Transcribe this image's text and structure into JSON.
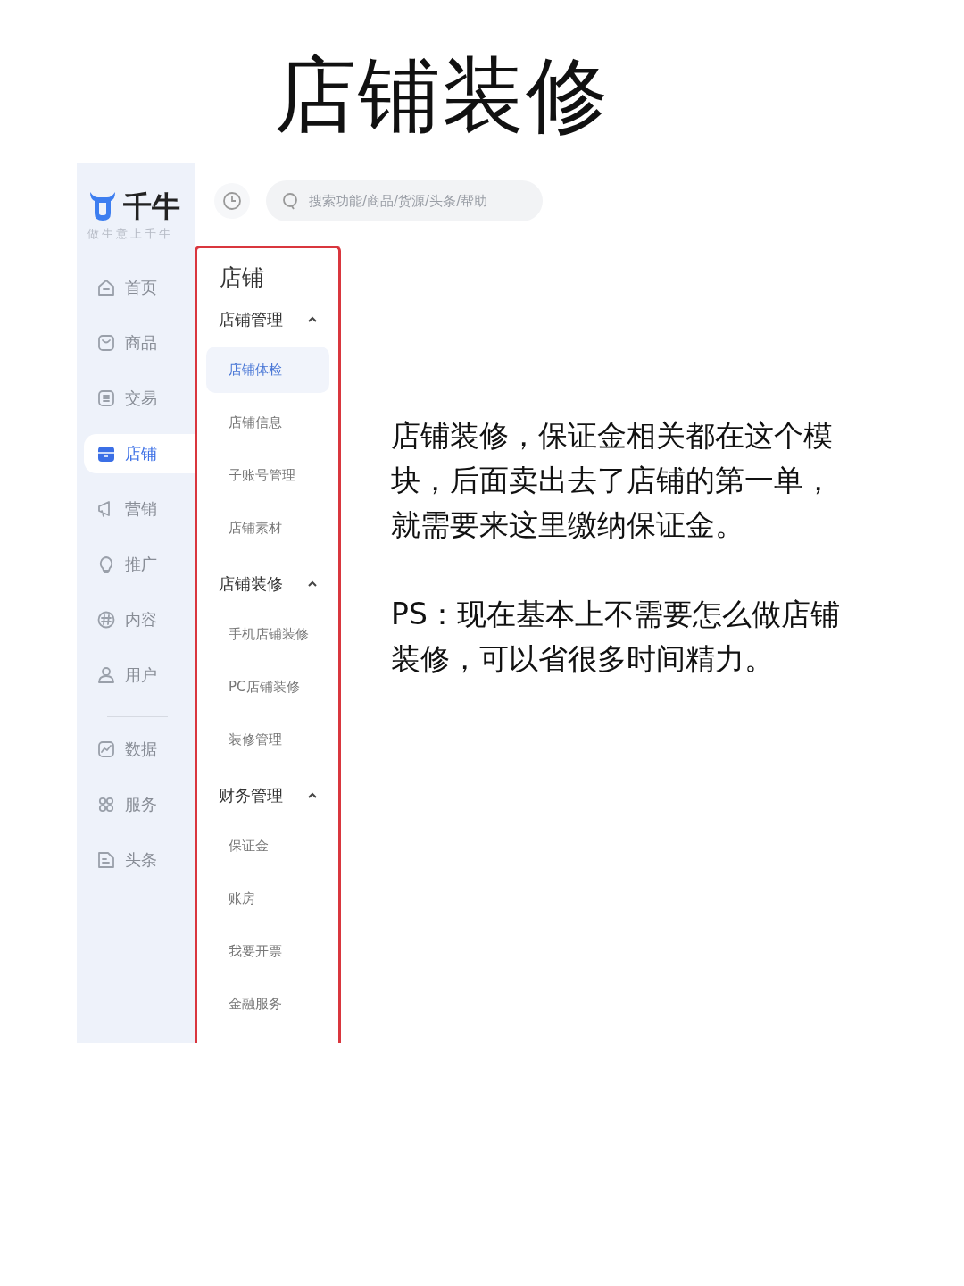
{
  "heading": "店铺装修",
  "app": {
    "logo": {
      "name": "千牛",
      "tagline": "做生意上千牛"
    },
    "search": {
      "placeholder": "搜索功能/商品/货源/头条/帮助"
    },
    "sidebar": {
      "sections": [
        {
          "items": [
            {
              "label": "首页",
              "selected": false
            },
            {
              "label": "商品",
              "selected": false
            },
            {
              "label": "交易",
              "selected": false
            },
            {
              "label": "店铺",
              "selected": true
            },
            {
              "label": "营销",
              "selected": false
            },
            {
              "label": "推广",
              "selected": false
            },
            {
              "label": "内容",
              "selected": false
            },
            {
              "label": "用户",
              "selected": false
            }
          ]
        },
        {
          "items": [
            {
              "label": "数据",
              "selected": false
            },
            {
              "label": "服务",
              "selected": false
            },
            {
              "label": "头条",
              "selected": false
            }
          ]
        }
      ]
    },
    "panel": {
      "title": "店铺",
      "highlighted": true,
      "groups": [
        {
          "label": "店铺管理",
          "expanded": true,
          "items": [
            {
              "label": "店铺体检",
              "selected": true
            },
            {
              "label": "店铺信息",
              "selected": false
            },
            {
              "label": "子账号管理",
              "selected": false
            },
            {
              "label": "店铺素材",
              "selected": false
            }
          ]
        },
        {
          "label": "店铺装修",
          "expanded": true,
          "items": [
            {
              "label": "手机店铺装修",
              "selected": false
            },
            {
              "label": "PC店铺装修",
              "selected": false
            },
            {
              "label": "装修管理",
              "selected": false
            }
          ]
        },
        {
          "label": "财务管理",
          "expanded": true,
          "items": [
            {
              "label": "保证金",
              "selected": false
            },
            {
              "label": "账房",
              "selected": false
            },
            {
              "label": "我要开票",
              "selected": false
            },
            {
              "label": "金融服务",
              "selected": false
            }
          ]
        }
      ]
    }
  },
  "notes": [
    "店铺装修，保证金相关都在这个模块，后面卖出去了店铺的第一单，就需要来这里缴纳保证金。",
    "PS：现在基本上不需要怎么做店铺装修，可以省很多时间精力。"
  ]
}
